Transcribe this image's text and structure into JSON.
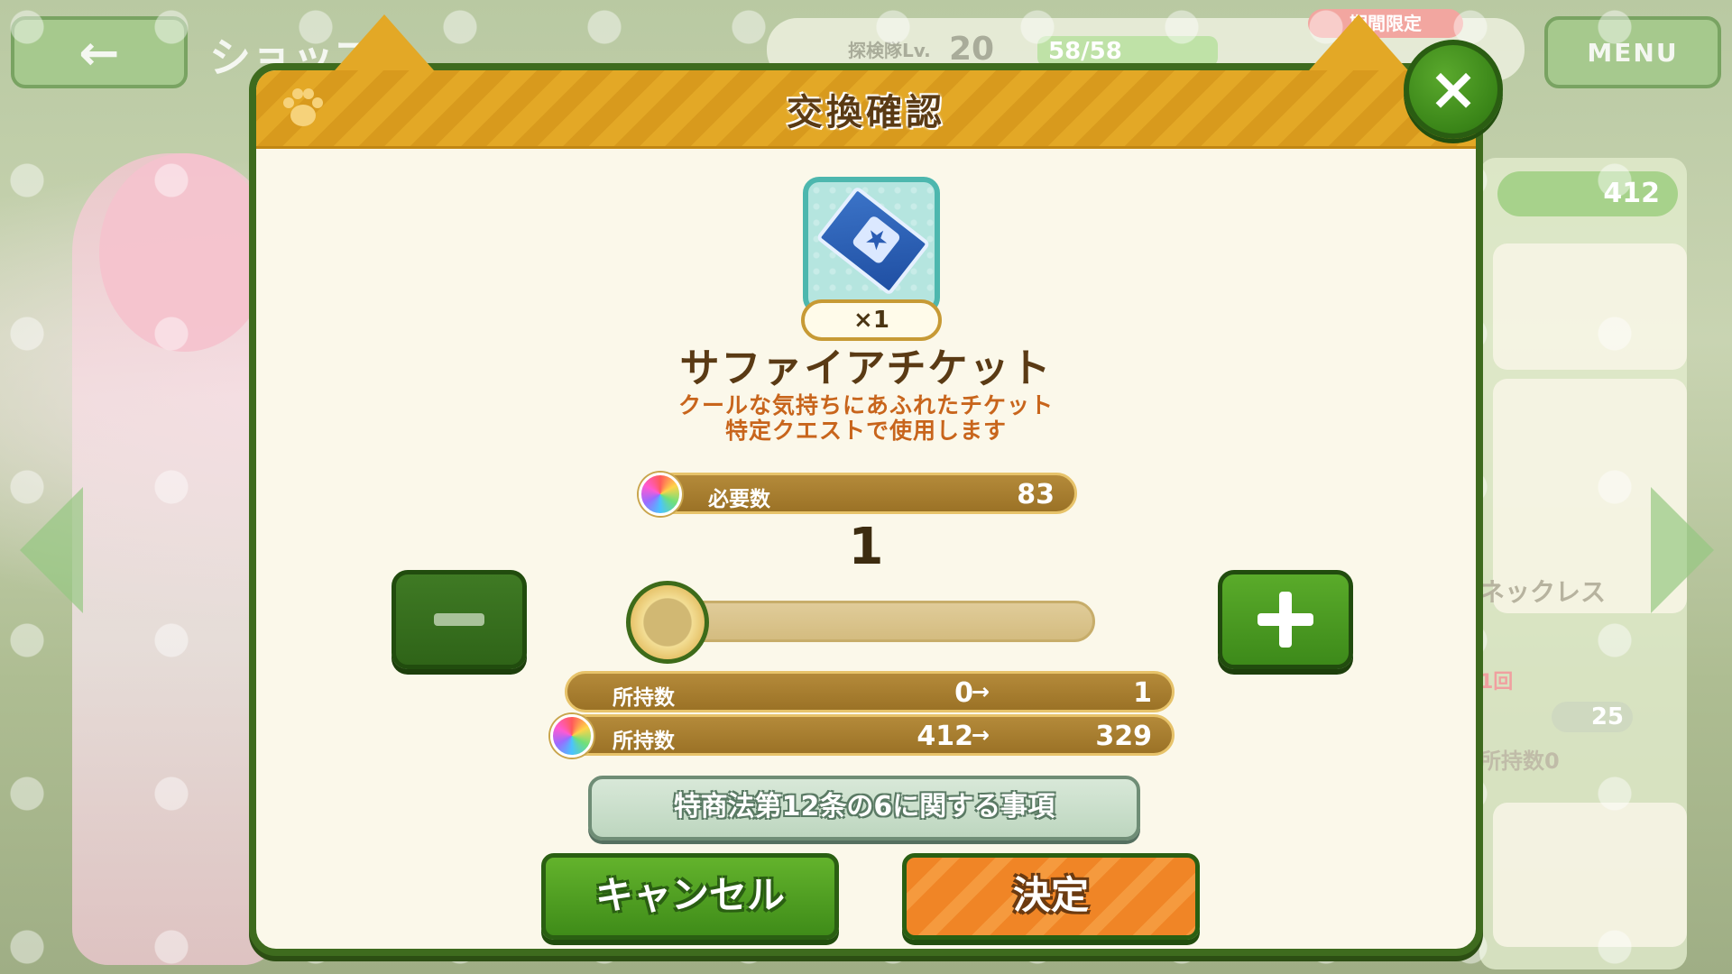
{
  "background": {
    "back_icon": "←",
    "shop_title": "ショップ",
    "help_icon": "?",
    "lv_label": "探検隊Lv.",
    "lv_value": "20",
    "stamina": "58/58",
    "limited_badge": "期間限定",
    "menu_label": "MENU",
    "gem_count": "412",
    "item_name_partial": "ネックレス",
    "limit_text": "1回",
    "price": "25",
    "owned": "所持数0"
  },
  "dialog": {
    "title": "交換確認",
    "close_icon": "×",
    "item": {
      "icon": "sapphire-ticket-icon",
      "quantity_label": "×1",
      "name": "サファイアチケット",
      "description_line1": "クールな気持ちにあふれたチケット",
      "description_line2": "特定クエストで使用します"
    },
    "required": {
      "label": "必要数",
      "value": "83"
    },
    "quantity": {
      "value": "1",
      "slider_fraction": 0.0
    },
    "owned_item": {
      "label": "所持数",
      "from": "0",
      "arrow": "→",
      "to": "1"
    },
    "owned_gem": {
      "label": "所持数",
      "from": "412",
      "arrow": "→",
      "to": "329"
    },
    "law_button_label": "特商法第12条の6に関する事項",
    "cancel_label": "キャンセル",
    "confirm_label": "決定"
  },
  "colors": {
    "header_gold": "#e3a826",
    "frame_green": "#3e6b1e",
    "confirm_orange": "#f08526",
    "description_orange": "#c8651c"
  }
}
